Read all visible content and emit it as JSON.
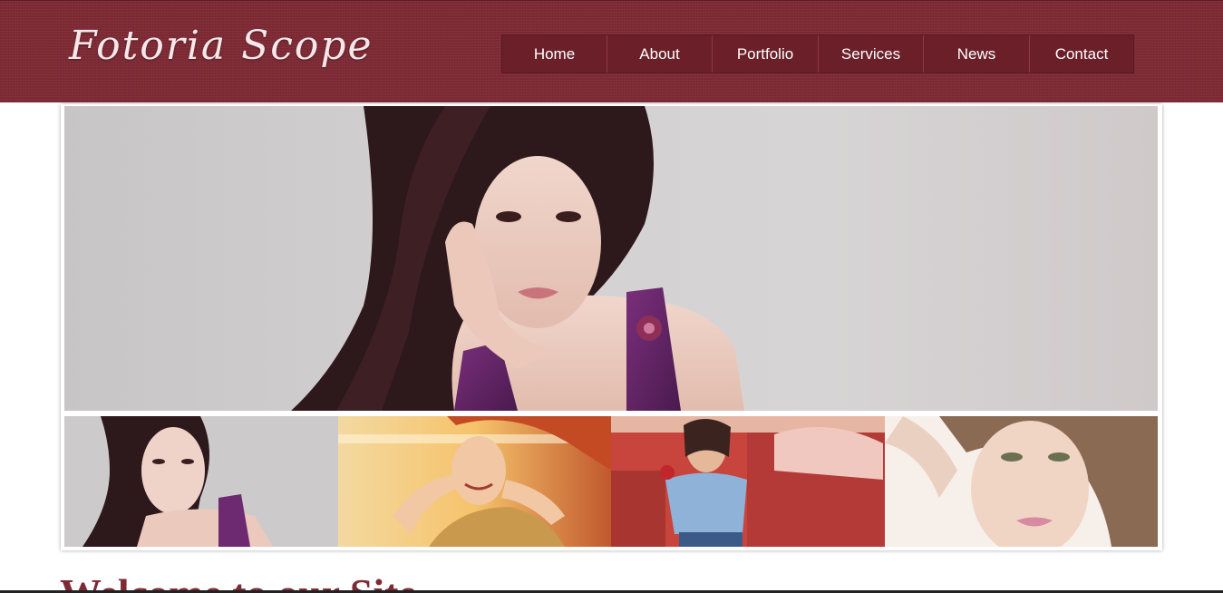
{
  "site": {
    "logo_text": "Fotoria Scope"
  },
  "nav": {
    "items": [
      {
        "label": "Home"
      },
      {
        "label": "About"
      },
      {
        "label": "Portfolio"
      },
      {
        "label": "Services"
      },
      {
        "label": "News"
      },
      {
        "label": "Contact"
      }
    ]
  },
  "main": {
    "welcome_heading": "Welcome to our Site"
  },
  "colors": {
    "header_bg": "#7e2a35",
    "nav_bg": "#6b1f29",
    "heading": "#7e2a35"
  }
}
